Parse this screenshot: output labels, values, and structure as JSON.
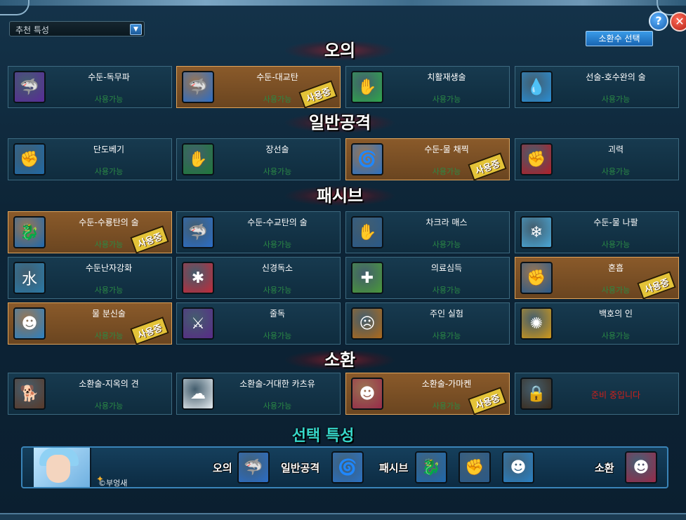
{
  "dropdown": {
    "selected": "추천 특성"
  },
  "buttons": {
    "help": "?",
    "close": "✕",
    "summon_select": "소환수 선택"
  },
  "sections": {
    "ougi": "오의",
    "normal": "일반공격",
    "passive": "패시브",
    "summon": "소환"
  },
  "status_available": "사용가능",
  "stamp_in_use": "사용중",
  "locked_text": "준비 중입니다",
  "cards": {
    "ougi": [
      {
        "name": "수둔-독무파",
        "active": false,
        "icon": "poison-shark-icon",
        "color": "#5a2a9a"
      },
      {
        "name": "수둔-대교탄",
        "active": true,
        "icon": "water-shark-icon",
        "color": "#2b6ec9"
      },
      {
        "name": "치활재생술",
        "active": false,
        "icon": "healing-leaf-icon",
        "color": "#2fa84b"
      },
      {
        "name": "선술-호수완의 술",
        "active": false,
        "icon": "water-arm-icon",
        "color": "#2a8fd6"
      }
    ],
    "normal": [
      {
        "name": "단도베기",
        "active": false,
        "icon": "fist-icon",
        "color": "#1f6aa8"
      },
      {
        "name": "장선술",
        "active": false,
        "icon": "green-palm-icon",
        "color": "#1f7a3a"
      },
      {
        "name": "수둔-물 채찍",
        "active": true,
        "icon": "water-whip-icon",
        "color": "#2a72c6"
      },
      {
        "name": "괴력",
        "active": false,
        "icon": "red-fist-icon",
        "color": "#b3202a"
      }
    ],
    "passive": [
      {
        "name": "수둔-수룡탄의 술",
        "active": true,
        "icon": "water-dragon-icon",
        "color": "#1f6ab0"
      },
      {
        "name": "수둔-수교탄의 술",
        "active": false,
        "icon": "shark-icon",
        "color": "#2b6ec9"
      },
      {
        "name": "차크라 매스",
        "active": false,
        "icon": "chakra-scalpel-icon",
        "color": "#2a5a8a"
      },
      {
        "name": "수둔-물 나팔",
        "active": false,
        "icon": "ice-wave-icon",
        "color": "#4aa8d8"
      },
      {
        "name": "수둔난자강화",
        "active": false,
        "icon": "water-kanji-icon",
        "color": "#2a7aa8"
      },
      {
        "name": "신경독소",
        "active": false,
        "icon": "brain-icon",
        "color": "#c42a3a"
      },
      {
        "name": "의료심득",
        "active": false,
        "icon": "medical-hand-icon",
        "color": "#4a9a3a"
      },
      {
        "name": "혼흡",
        "active": true,
        "icon": "gauntlet-icon",
        "color": "#2a5a8a"
      },
      {
        "name": "물 분신술",
        "active": true,
        "icon": "water-clone-icon",
        "color": "#2a82c6"
      },
      {
        "name": "줄독",
        "active": false,
        "icon": "poison-blade-icon",
        "color": "#5a2a8a"
      },
      {
        "name": "주인 실험",
        "active": false,
        "icon": "puppet-face-icon",
        "color": "#b06a1a"
      },
      {
        "name": "백호의 인",
        "active": false,
        "icon": "tiger-icon",
        "color": "#d29a1a"
      }
    ],
    "summon": [
      {
        "name": "소환술-지옥의 견",
        "active": false,
        "icon": "hell-hound-icon",
        "color": "#5a3a2a"
      },
      {
        "name": "소환술-거대한 카츠유",
        "active": false,
        "icon": "slug-icon",
        "color": "#e8eef2"
      },
      {
        "name": "소환술-가마켄",
        "active": true,
        "icon": "gamaken-toad-icon",
        "color": "#9a2a4a"
      },
      {
        "name": "",
        "active": false,
        "locked": true,
        "icon": "padlock-icon",
        "color": "#3a2a1a"
      }
    ]
  },
  "selection": {
    "title": "선택 특성",
    "labels": {
      "ougi": "오의",
      "normal": "일반공격",
      "passive": "패시브",
      "summon": "소환"
    },
    "copyright": "©부엉새",
    "icons": {
      "ougi": {
        "icon": "water-shark-icon",
        "color": "#2b6ec9"
      },
      "normal": {
        "icon": "water-whip-icon",
        "color": "#2a72c6"
      },
      "passive": [
        {
          "icon": "water-dragon-icon",
          "color": "#1f6ab0"
        },
        {
          "icon": "gauntlet-icon",
          "color": "#2a5a8a"
        },
        {
          "icon": "water-clone-icon",
          "color": "#2a82c6"
        }
      ],
      "summon": {
        "icon": "gamaken-toad-icon",
        "color": "#9a2a4a"
      }
    }
  }
}
